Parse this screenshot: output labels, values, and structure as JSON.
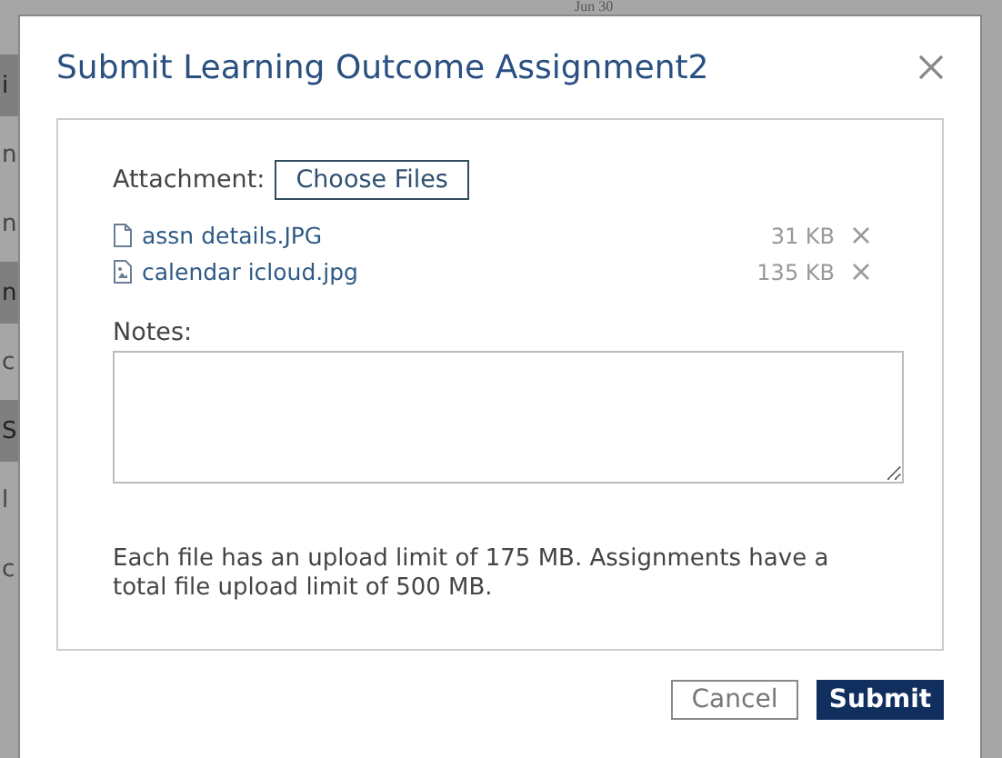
{
  "background": {
    "date": "Jun 30",
    "fragments": [
      {
        "text": "i",
        "selected": true
      },
      {
        "text": "n",
        "selected": false
      },
      {
        "text": "n",
        "selected": false
      },
      {
        "text": "n",
        "selected": true
      },
      {
        "text": "c",
        "selected": false
      },
      {
        "text": "S",
        "selected": true
      },
      {
        "text": "l",
        "selected": false
      },
      {
        "text": "c",
        "selected": false
      }
    ]
  },
  "dialog": {
    "title": "Submit Learning Outcome Assignment2",
    "attachment_label": "Attachment:",
    "choose_button": "Choose Files",
    "files": [
      {
        "name": "assn details.JPG",
        "size": "31 KB",
        "kind": "document"
      },
      {
        "name": "calendar icloud.jpg",
        "size": "135 KB",
        "kind": "image"
      }
    ],
    "notes_label": "Notes:",
    "info": "Each file has an upload limit of 175 MB. Assignments have a total file upload limit of 500 MB.",
    "buttons": [
      {
        "label": "Cancel",
        "kind": "secondary"
      },
      {
        "label": "Submit",
        "kind": "primary"
      }
    ]
  }
}
